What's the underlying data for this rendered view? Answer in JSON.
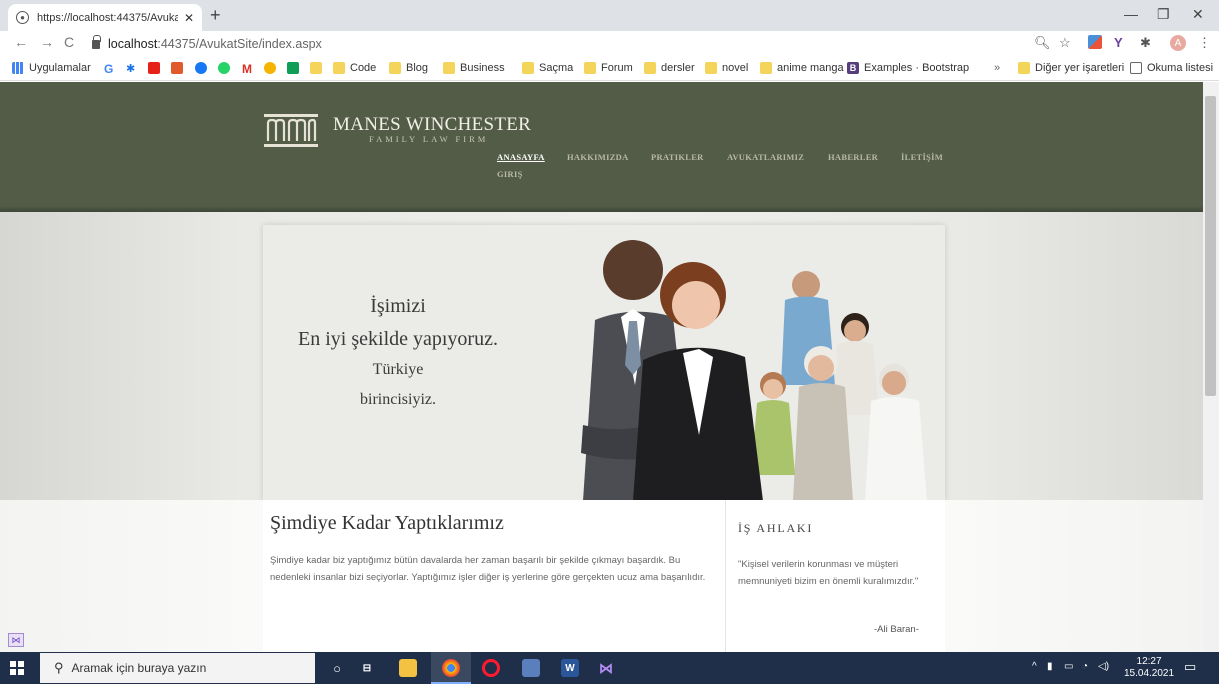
{
  "browser": {
    "tab_title": "https://localhost:44375/AvukatSi",
    "url_host": "localhost",
    "url_rest": ":44375/AvukatSite/index.aspx",
    "bookmarks": [
      {
        "label": "Uygulamalar",
        "icon": "apps-grid-icon"
      },
      {
        "label": "Code",
        "icon": "folder-icon"
      },
      {
        "label": "Blog",
        "icon": "folder-icon"
      },
      {
        "label": "Business",
        "icon": "folder-icon"
      },
      {
        "label": "Saçma",
        "icon": "folder-icon"
      },
      {
        "label": "Forum",
        "icon": "folder-icon"
      },
      {
        "label": "dersler",
        "icon": "folder-icon"
      },
      {
        "label": "novel",
        "icon": "folder-icon"
      },
      {
        "label": "anime manga",
        "icon": "folder-icon"
      },
      {
        "label": "Examples · Bootstrap",
        "icon": "bootstrap-icon"
      }
    ],
    "other_bookmarks": "Diğer yer işaretleri",
    "reading_list": "Okuma listesi",
    "avatar_letter": "A"
  },
  "site": {
    "brand_name": "MANES WINCHESTER",
    "brand_tagline": "FAMILY LAW FIRM",
    "nav": [
      {
        "label": "ANASAYFA",
        "active": true
      },
      {
        "label": "HAKKIMIZDA",
        "active": false
      },
      {
        "label": "PRATIKLER",
        "active": false
      },
      {
        "label": "AVUKATLARIMIZ",
        "active": false
      },
      {
        "label": "HABERLER",
        "active": false
      },
      {
        "label": "İLETİŞİM",
        "active": false
      },
      {
        "label": "GIRIŞ",
        "active": false
      }
    ],
    "hero": {
      "line1": "İşimizi",
      "line2": "En iyi şekilde yapıyoruz.",
      "line3": "Türkiye",
      "line4": "birincisiyiz."
    },
    "section_title": "Şimdiye Kadar Yaptıklarımız",
    "section_body": "Şimdiye kadar biz yaptığımız bütün davalarda her zaman başarılı bir şekilde çıkmayı başardık. Bu nedenleki insanlar bizi seçiyorlar. Yaptığımız işler diğer iş yerlerine göre gerçekten ucuz ama başarılıdır.",
    "side_title": "İŞ AHLAKI",
    "side_quote": "\"Kişisel verilerin korunması ve müşteri memnuniyeti bizim en önemli kuralımızdır.\"",
    "side_author": "-Ali Baran-"
  },
  "taskbar": {
    "search_placeholder": "Aramak için buraya yazın",
    "time": "12:27",
    "date": "15.04.2021"
  },
  "colors": {
    "header_bg": "#525c47",
    "hero_bg": "#ebebe8",
    "taskbar_bg": "#1f2f4a"
  }
}
